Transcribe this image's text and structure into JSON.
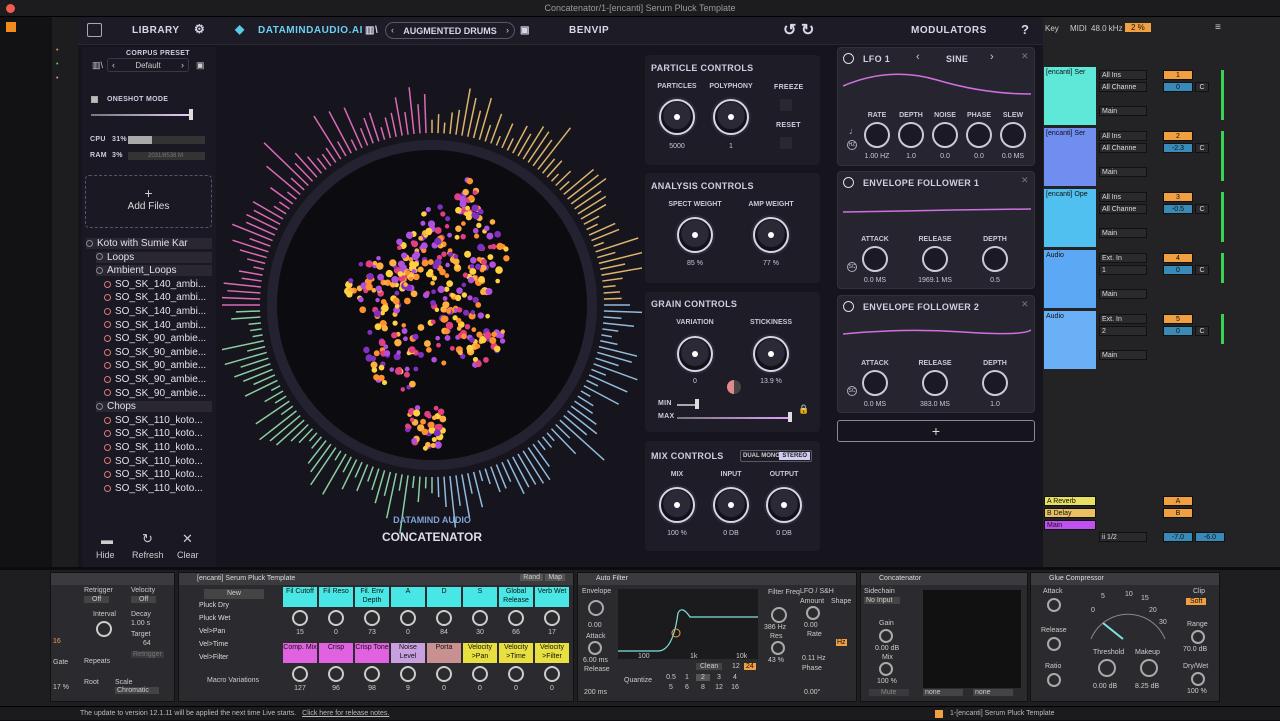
{
  "window": {
    "title": "Concatenator/1-[encanti] Serum Pluck Template"
  },
  "header": {
    "library": "LIBRARY",
    "brand": "DATAMINDAUDIO.AI",
    "preset": "AUGMENTED DRUMS",
    "user": "BENVIP",
    "modulators": "MODULATORS",
    "help": "?"
  },
  "sidebar": {
    "corpus_label": "CORPUS PRESET",
    "corpus_value": "Default",
    "oneshot": "ONESHOT MODE",
    "cpu_label": "CPU",
    "cpu_val": "31%",
    "ram_label": "RAM",
    "ram_val": "3%",
    "ram_detail": "2031/8538 M",
    "add_files": "Add Files",
    "tree": [
      "Koto with Sumie Kar",
      "Loops",
      "Ambient_Loops",
      "SO_SK_140_ambi...",
      "SO_SK_140_ambi...",
      "SO_SK_140_ambi...",
      "SO_SK_140_ambi...",
      "SO_SK_90_ambie...",
      "SO_SK_90_ambie...",
      "SO_SK_90_ambie...",
      "SO_SK_90_ambie...",
      "SO_SK_90_ambie...",
      "Chops",
      "SO_SK_110_koto...",
      "SO_SK_110_koto...",
      "SO_SK_110_koto...",
      "SO_SK_110_koto...",
      "SO_SK_110_koto...",
      "SO_SK_110_koto..."
    ],
    "hide": "Hide",
    "refresh": "Refresh",
    "clear": "Clear"
  },
  "center": {
    "brand_small": "DATAMIND AUDIO",
    "brand_big": "CONCATENATOR"
  },
  "particle": {
    "title": "PARTICLE CONTROLS",
    "particles_l": "PARTICLES",
    "particles_v": "5000",
    "poly_l": "POLYPHONY",
    "poly_v": "1",
    "freeze": "FREEZE",
    "reset": "RESET"
  },
  "analysis": {
    "title": "ANALYSIS CONTROLS",
    "spect_l": "SPECT WEIGHT",
    "spect_v": "85 %",
    "amp_l": "AMP WEIGHT",
    "amp_v": "77 %"
  },
  "grain": {
    "title": "GRAIN CONTROLS",
    "var_l": "VARIATION",
    "var_v": "0",
    "stick_l": "STICKINESS",
    "stick_v": "13.9 %",
    "min": "MIN",
    "max": "MAX"
  },
  "mix": {
    "title": "MIX CONTROLS",
    "dual": "DUAL MONO",
    "stereo": "STEREO",
    "mix_l": "MIX",
    "mix_v": "100 %",
    "in_l": "INPUT",
    "in_v": "0 DB",
    "out_l": "OUTPUT",
    "out_v": "0 DB"
  },
  "lfo": {
    "title": "LFO 1",
    "wave": "SINE",
    "rate_l": "RATE",
    "rate_v": "1.00 HZ",
    "depth_l": "DEPTH",
    "depth_v": "1.0",
    "noise_l": "NOISE",
    "noise_v": "0.0",
    "phase_l": "PHASE",
    "phase_v": "0.0",
    "slew_l": "SLEW",
    "slew_v": "0.0 MS"
  },
  "env1": {
    "title": "ENVELOPE FOLLOWER 1",
    "attack_l": "ATTACK",
    "attack_v": "0.0 MS",
    "release_l": "RELEASE",
    "release_v": "1969.1 MS",
    "depth_l": "DEPTH",
    "depth_v": "0.5"
  },
  "env2": {
    "title": "ENVELOPE FOLLOWER 2",
    "attack_l": "ATTACK",
    "attack_v": "0.0 MS",
    "release_l": "RELEASE",
    "release_v": "383.0 MS",
    "depth_l": "DEPTH",
    "depth_v": "1.0"
  },
  "add_mod": "+",
  "right": {
    "key": "Key",
    "midi": "MIDI",
    "rate": "48.0 kHz",
    "cpu": "2 %",
    "tracks": [
      {
        "name": "[encanti] Ser",
        "in": "All Ins",
        "ch": "All Channe",
        "mon": "Main",
        "num": "1",
        "vol": "0",
        "c": "C",
        "color": "#5de8d8"
      },
      {
        "name": "[encanti] Ser",
        "in": "All Ins",
        "ch": "All Channe",
        "mon": "Main",
        "num": "2",
        "vol": "-2.3",
        "c": "C",
        "color": "#6f8ef0"
      },
      {
        "name": "[encanti] Ope",
        "in": "All Ins",
        "ch": "All Channe",
        "mon": "Main",
        "num": "3",
        "vol": "-0.5",
        "c": "C",
        "color": "#4fc0f0"
      },
      {
        "name": "Audio",
        "in": "Ext. In",
        "ch": "1",
        "mon": "Main",
        "num": "4",
        "vol": "0",
        "c": "C",
        "color": "#5da8f5"
      },
      {
        "name": "Audio",
        "in": "Ext. In",
        "ch": "2",
        "mon": "Main",
        "num": "5",
        "vol": "0",
        "c": "C",
        "color": "#6ab0f7"
      }
    ],
    "returns": [
      {
        "name": "A Reverb",
        "num": "A",
        "color": "#e8e060"
      },
      {
        "name": "B Delay",
        "num": "B",
        "color": "#e8c060"
      },
      {
        "name": "Main",
        "num": "",
        "color": "#c050f0"
      }
    ],
    "master_vol": "-7.0",
    "master_vol2": "-6.0",
    "io": "ii 1/2"
  },
  "serum": {
    "title": "[encanti] Serum Pluck Template",
    "rand": "Rand",
    "map": "Map",
    "new": "New",
    "items": [
      "Pluck Dry",
      "Pluck Wet",
      "Vel>Pan",
      "Vel>Time",
      "Vel>Filter"
    ],
    "macro_label": "Macro Variations",
    "row1": [
      {
        "l": "Fil Cutoff",
        "v": "15",
        "c": "#49e6e6"
      },
      {
        "l": "Fil Reso",
        "v": "0",
        "c": "#49e6e6"
      },
      {
        "l": "Fil. Env Depth",
        "v": "73",
        "c": "#49e6e6"
      },
      {
        "l": "A",
        "v": "0",
        "c": "#49e6e6"
      },
      {
        "l": "D",
        "v": "84",
        "c": "#49e6e6"
      },
      {
        "l": "S",
        "v": "30",
        "c": "#49e6e6"
      },
      {
        "l": "Global Release",
        "v": "66",
        "c": "#49e6e6"
      },
      {
        "l": "Verb Wet",
        "v": "17",
        "c": "#49e6e6"
      }
    ],
    "row2": [
      {
        "l": "Comp. Mix",
        "v": "127",
        "c": "#e062e0"
      },
      {
        "l": "Crisp",
        "v": "96",
        "c": "#e062e0"
      },
      {
        "l": "Crisp Tone",
        "v": "98",
        "c": "#e062e0"
      },
      {
        "l": "Noise Level",
        "v": "9",
        "c": "#c8a0e0"
      },
      {
        "l": "Porta",
        "v": "0",
        "c": "#c89090"
      },
      {
        "l": "Velocity >Pan",
        "v": "0",
        "c": "#e8e040"
      },
      {
        "l": "Velocity >Time",
        "v": "0",
        "c": "#e8e040"
      },
      {
        "l": "Velocity >Filter",
        "v": "0",
        "c": "#e8e040"
      }
    ]
  },
  "left_dev": {
    "retrigger": "Retrigger",
    "off": "Off",
    "velocity": "Velocity",
    "interval": "Interval",
    "decay": "Decay",
    "decay_v": "1.00 s",
    "target": "Target",
    "target_v": "64",
    "retrig_btn": "Retrigger",
    "repeats": "Repeats",
    "root": "Root",
    "scale": "Scale",
    "scale_v": "Chromatic",
    "gate": "Gate",
    "gate_v": "17 %",
    "val16": "16"
  },
  "autofilter": {
    "title": "Auto Filter",
    "envelope": "Envelope",
    "env_v": "0.00",
    "attack": "Attack",
    "attack_v": "6.00 ms",
    "release": "Release",
    "release_v": "200 ms",
    "freq": "Filter Freq",
    "freq_v": "386 Hz",
    "res": "Res",
    "res_v": "43 %",
    "ticks": [
      "100",
      "1k",
      "10k"
    ],
    "clean": "Clean",
    "n12": "12",
    "n24": "24",
    "quantize": "Quantize",
    "qvals": [
      "0.5",
      "1",
      "2",
      "3",
      "4",
      "5",
      "6",
      "8",
      "12",
      "16"
    ],
    "lfo": "LFO / S&H",
    "amount": "Amount",
    "amount_v": "0.00",
    "rate": "Rate",
    "rate_v": "0.11 Hz",
    "phase": "Phase",
    "phase_v": "0.00°",
    "shape": "Shape",
    "hz": "Hz"
  },
  "concat_dev": {
    "title": "Concatenator",
    "sidechain": "Sidechain",
    "no_input": "No Input",
    "gain": "Gain",
    "gain_v": "0.00 dB",
    "mix": "Mix",
    "mix_v": "100 %",
    "mute": "Mute",
    "none1": "none",
    "none2": "none"
  },
  "glue": {
    "title": "Glue Compressor",
    "attack": "Attack",
    "release": "Release",
    "ratio": "Ratio",
    "threshold": "Threshold",
    "threshold_v": "0.00 dB",
    "makeup": "Makeup",
    "makeup_v": "8.25 dB",
    "clip": "Clip",
    "soft": "Soft",
    "range": "Range",
    "range_v": "70.0 dB",
    "drywet": "Dry/Wet",
    "drywet_v": "100 %",
    "scale": [
      "5",
      "10",
      "15",
      "20",
      "0",
      "30"
    ]
  },
  "status": {
    "msg": "The update to version 12.1.11 will be applied the next time Live starts.",
    "link": "Click here for release notes.",
    "track": "1-[encanti] Serum Pluck Template"
  }
}
